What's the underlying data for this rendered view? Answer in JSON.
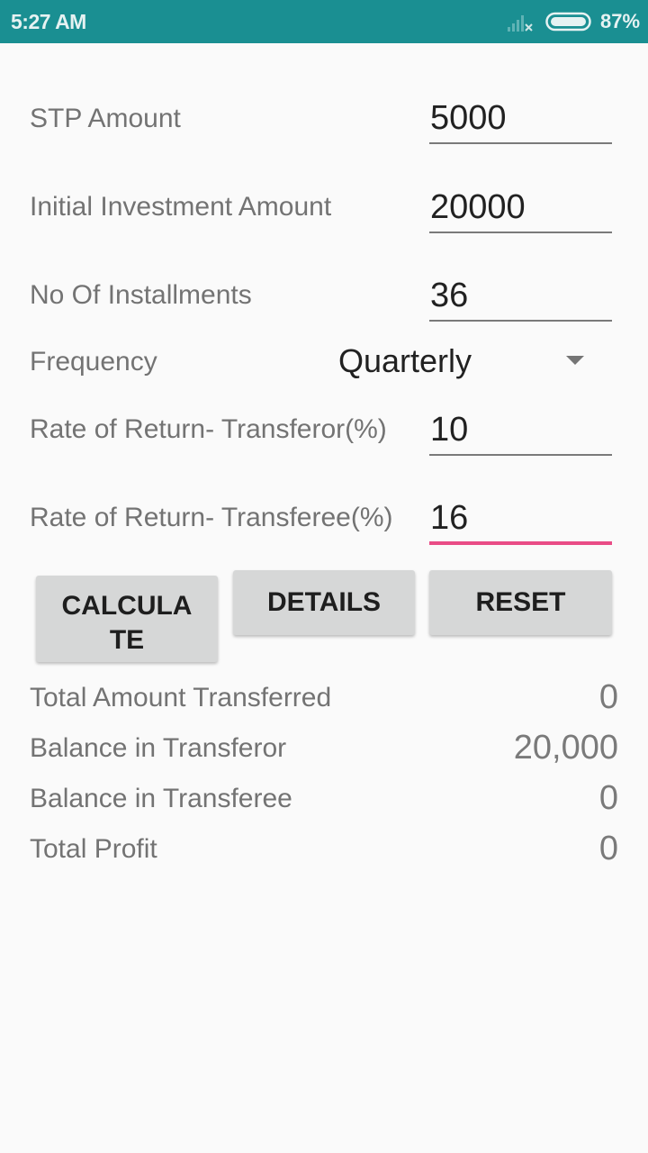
{
  "status_bar": {
    "time": "5:27 AM",
    "battery_percent": "87%",
    "signal_icon": "signal-no-service-icon",
    "battery_icon": "battery-icon",
    "background_color": "#1a8f92"
  },
  "form": {
    "stp_amount": {
      "label": "STP Amount",
      "value": "5000"
    },
    "initial_investment": {
      "label": "Initial Investment Amount",
      "value": "20000"
    },
    "installments": {
      "label": "No Of Installments",
      "value": "36"
    },
    "frequency": {
      "label": "Frequency",
      "selected": "Quarterly",
      "caret_icon": "dropdown-caret-icon"
    },
    "rate_transferor": {
      "label": "Rate of Return- Transferor(%)",
      "value": "10"
    },
    "rate_transferee": {
      "label": "Rate of Return- Transferee(%)",
      "value": "16",
      "focused": true,
      "accent_color": "#e94c86"
    }
  },
  "buttons": {
    "calculate": "CALCULATE",
    "details": "DETAILS",
    "reset": "RESET"
  },
  "results": [
    {
      "label": "Total Amount Transferred",
      "value": "0"
    },
    {
      "label": "Balance in Transferor",
      "value": "20,000"
    },
    {
      "label": "Balance in Transferee",
      "value": "0"
    },
    {
      "label": "Total Profit",
      "value": "0"
    }
  ]
}
